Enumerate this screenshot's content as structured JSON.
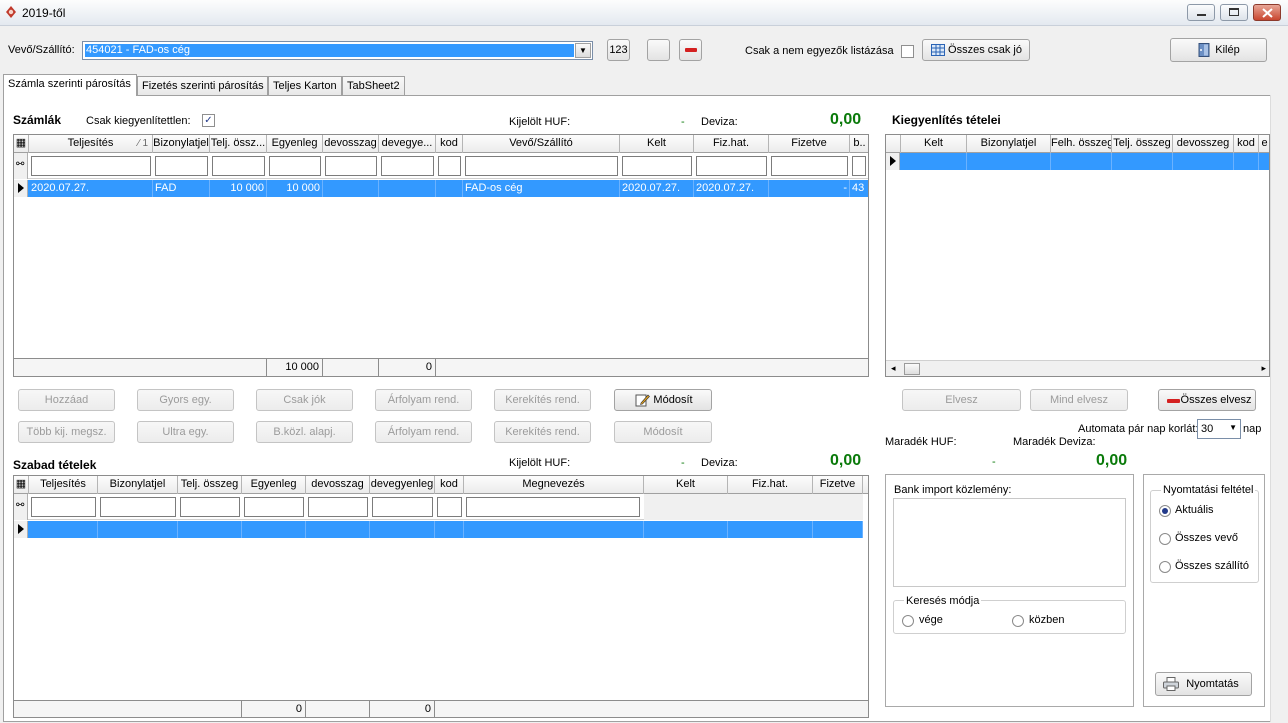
{
  "window": {
    "title": "2019-től"
  },
  "top": {
    "customer_label": "Vevő/Szállító:",
    "customer_value": "454021 - FAD-os cég",
    "btn_123": "123",
    "only_mismatch_label": "Csak a nem egyezők listázása",
    "all_ok_btn": "Összes csak jó",
    "exit_btn": "Kilép"
  },
  "tabs": [
    "Számla szerinti párosítás",
    "Fizetés szerinti párosítás",
    "Teljes Karton",
    "TabSheet2"
  ],
  "invoices": {
    "title": "Számlák",
    "unbalanced_label": "Csak kiegyenlítettlen:",
    "selected_huf_label": "Kijelölt HUF:",
    "selected_huf_value": "-",
    "currency_label": "Deviza:",
    "currency_value": "0,00",
    "columns": [
      "Teljesítés",
      "Bizonylatjel",
      "Telj. össz...",
      "Egyenleg",
      "devosszag",
      "devegye...",
      "kod",
      "Vevő/Szállító",
      "Kelt",
      "Fiz.hat.",
      "Fizetve",
      "b.."
    ],
    "sort_mark": "1",
    "row": [
      "2020.07.27.",
      "FAD",
      "10 000",
      "10 000",
      "",
      "",
      "",
      "FAD-os cég",
      "2020.07.27.",
      "2020.07.27.",
      "-",
      "43"
    ],
    "totals": {
      "egyenleg": "10 000",
      "devegyenleg": "0"
    }
  },
  "actions_row1": [
    "Hozzáad",
    "Gyors egy.",
    "Csak jók",
    "Árfolyam rend.",
    "Kerekítés rend.",
    "Módosít"
  ],
  "actions_row2": [
    "Több kij. megsz.",
    "Ultra egy.",
    "B.közl. alapj.",
    "Árfolyam rend.",
    "Kerekítés rend.",
    "Módosít"
  ],
  "settlement": {
    "title": "Kiegyenlítés tételei",
    "columns": [
      "Kelt",
      "Bizonylatjel",
      "Felh. összeg",
      "Telj. összeg",
      "devosszeg",
      "kod",
      "e"
    ],
    "remove_btn": "Elvesz",
    "remove_all_btn": "Mind elvesz",
    "remove_total_btn": "Összes elvesz",
    "auto_pair_label": "Automata pár nap korlát:",
    "auto_pair_value": "30",
    "auto_pair_unit": "nap",
    "rem_huf_label": "Maradék HUF:",
    "rem_huf_value": "-",
    "rem_currency_label": "Maradék Deviza:",
    "rem_currency_value": "0,00"
  },
  "free": {
    "title": "Szabad tételek",
    "selected_huf_label": "Kijelölt HUF:",
    "selected_huf_value": "-",
    "currency_label": "Deviza:",
    "currency_value": "0,00",
    "columns": [
      "Teljesítés",
      "Bizonylatjel",
      "Telj. összeg",
      "Egyenleg",
      "devosszag",
      "devegyenleg",
      "kod",
      "Megnevezés",
      "Kelt",
      "Fiz.hat.",
      "Fizetve"
    ],
    "totals": {
      "egyenleg": "0",
      "devegyenleg": "0"
    }
  },
  "bank": {
    "title": "Bank import közlemény:",
    "search_mode_title": "Keresés módja",
    "search_end": "vége",
    "search_within": "közben"
  },
  "print": {
    "title": "Nyomtatási feltétel",
    "opt_current": "Aktuális",
    "opt_all_customers": "Összes vevő",
    "opt_all_suppliers": "Összes szállító",
    "print_btn": "Nyomtatás"
  }
}
